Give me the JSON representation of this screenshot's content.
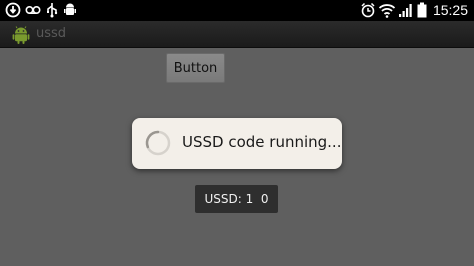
{
  "status_bar": {
    "left_icons": [
      "usb-debug-icon",
      "voicemail-icon",
      "usb-icon",
      "android-debug-icon"
    ],
    "right_icons": [
      "alarm-icon",
      "wifi-icon",
      "signal-icon",
      "battery-icon"
    ],
    "time": "15:25"
  },
  "app": {
    "title": "ussd",
    "icon": "android-icon"
  },
  "main": {
    "button_label": "Button"
  },
  "dialog": {
    "message": "USSD code running..."
  },
  "toast": {
    "text": "USSD: 1  0"
  },
  "colors": {
    "background": "#5f5f5f",
    "dialog": "#f3efe9",
    "toast": "#2e2e2e"
  }
}
